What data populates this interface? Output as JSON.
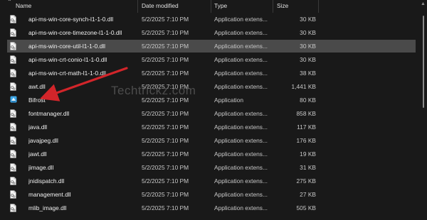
{
  "header": {
    "name": "Name",
    "date_modified": "Date modified",
    "type": "Type",
    "size": "Size"
  },
  "files": [
    {
      "name": "api-ms-win-core-synch-l1-1-0.dll",
      "date": "5/2/2025 7:10 PM",
      "type": "Application extens...",
      "size": "30 KB",
      "icon": "dll-file-icon"
    },
    {
      "name": "api-ms-win-core-timezone-l1-1-0.dll",
      "date": "5/2/2025 7:10 PM",
      "type": "Application extens...",
      "size": "30 KB",
      "icon": "dll-file-icon"
    },
    {
      "name": "api-ms-win-core-util-l1-1-0.dll",
      "date": "5/2/2025 7:10 PM",
      "type": "Application extens...",
      "size": "30 KB",
      "icon": "dll-file-icon",
      "selected": true
    },
    {
      "name": "api-ms-win-crt-conio-l1-1-0.dll",
      "date": "5/2/2025 7:10 PM",
      "type": "Application extens...",
      "size": "30 KB",
      "icon": "dll-file-icon"
    },
    {
      "name": "api-ms-win-crt-math-l1-1-0.dll",
      "date": "5/2/2025 7:10 PM",
      "type": "Application extens...",
      "size": "38 KB",
      "icon": "dll-file-icon"
    },
    {
      "name": "awt.dll",
      "date": "5/2/2025 7:10 PM",
      "type": "Application extens...",
      "size": "1,441 KB",
      "icon": "dll-file-icon"
    },
    {
      "name": "Bifrost",
      "date": "5/2/2025 7:10 PM",
      "type": "Application",
      "size": "80 KB",
      "icon": "application-icon"
    },
    {
      "name": "fontmanager.dll",
      "date": "5/2/2025 7:10 PM",
      "type": "Application extens...",
      "size": "858 KB",
      "icon": "dll-file-icon"
    },
    {
      "name": "java.dll",
      "date": "5/2/2025 7:10 PM",
      "type": "Application extens...",
      "size": "117 KB",
      "icon": "dll-file-icon"
    },
    {
      "name": "javajpeg.dll",
      "date": "5/2/2025 7:10 PM",
      "type": "Application extens...",
      "size": "176 KB",
      "icon": "dll-file-icon"
    },
    {
      "name": "jawt.dll",
      "date": "5/2/2025 7:10 PM",
      "type": "Application extens...",
      "size": "19 KB",
      "icon": "dll-file-icon"
    },
    {
      "name": "jimage.dll",
      "date": "5/2/2025 7:10 PM",
      "type": "Application extens...",
      "size": "31 KB",
      "icon": "dll-file-icon"
    },
    {
      "name": "jnidispatch.dll",
      "date": "5/2/2025 7:10 PM",
      "type": "Application extens...",
      "size": "275 KB",
      "icon": "dll-file-icon"
    },
    {
      "name": "management.dll",
      "date": "5/2/2025 7:10 PM",
      "type": "Application extens...",
      "size": "27 KB",
      "icon": "dll-file-icon"
    },
    {
      "name": "mlib_image.dll",
      "date": "5/2/2025 7:10 PM",
      "type": "Application extens...",
      "size": "505 KB",
      "icon": "dll-file-icon"
    }
  ],
  "watermark": "Techtrickz.com",
  "colors": {
    "background": "#191919",
    "selected_row": "#4a4a4a",
    "arrow": "#d2252a",
    "app_icon": "#3fa8e8"
  }
}
